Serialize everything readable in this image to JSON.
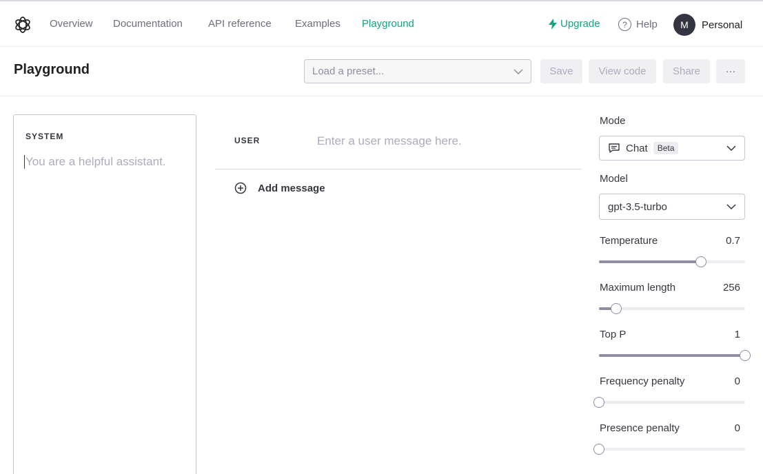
{
  "nav": {
    "links": [
      "Overview",
      "Documentation",
      "API reference",
      "Examples",
      "Playground"
    ],
    "active_link": "Playground",
    "upgrade": "Upgrade",
    "help": "Help",
    "help_icon": "?",
    "account_initial": "M",
    "account_name": "Personal",
    "accent_color": "#10a37f"
  },
  "header": {
    "title": "Playground",
    "preset_placeholder": "Load a preset...",
    "save": "Save",
    "view_code": "View code",
    "share": "Share",
    "more": "···"
  },
  "system": {
    "label": "SYSTEM",
    "placeholder": "You are a helpful assistant."
  },
  "messages": {
    "user_label": "USER",
    "user_placeholder": "Enter a user message here.",
    "add_message": "Add message"
  },
  "settings": {
    "mode_label": "Mode",
    "mode_value": "Chat",
    "mode_badge": "Beta",
    "model_label": "Model",
    "model_value": "gpt-3.5-turbo",
    "sliders": [
      {
        "label": "Temperature",
        "value": "0.7",
        "fraction": 0.7
      },
      {
        "label": "Maximum length",
        "value": "256",
        "fraction": 0.12
      },
      {
        "label": "Top P",
        "value": "1",
        "fraction": 1.0
      },
      {
        "label": "Frequency penalty",
        "value": "0",
        "fraction": 0.0
      },
      {
        "label": "Presence penalty",
        "value": "0",
        "fraction": 0.0
      }
    ]
  }
}
